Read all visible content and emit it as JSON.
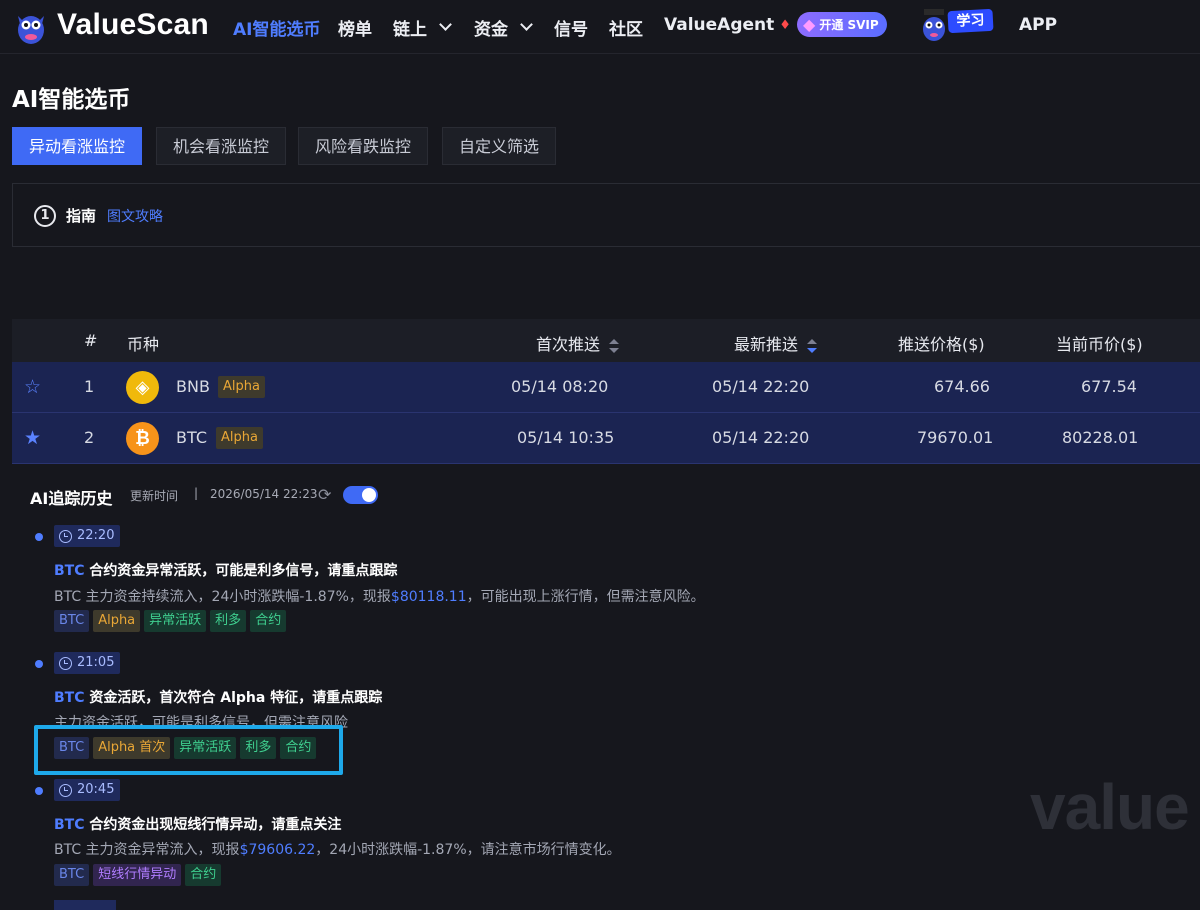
{
  "nav": {
    "logo": "ValueScan",
    "items": [
      {
        "label": "AI智能选币",
        "active": true
      },
      {
        "label": "榜单"
      },
      {
        "label": "链上",
        "dropdown": true
      },
      {
        "label": "资金",
        "dropdown": true
      },
      {
        "label": "信号"
      },
      {
        "label": "社区"
      },
      {
        "label": "ValueAgent"
      },
      {
        "label": "APP"
      }
    ],
    "svip_label": "开通 SVIP",
    "learn_label": "学习"
  },
  "page": {
    "title": "AI智能选币",
    "tabs": [
      "异动看涨监控",
      "机会看涨监控",
      "风险看跌监控",
      "自定义筛选"
    ],
    "active_tab": 0
  },
  "guide": {
    "number": "1",
    "label": "指南",
    "link": "图文攻略"
  },
  "table": {
    "headers": {
      "index": "#",
      "coin": "币种",
      "first_push": "首次推送",
      "latest_push": "最新推送",
      "push_price": "推送价格($)",
      "current_price": "当前币价($)"
    },
    "rows": [
      {
        "index": "1",
        "coin": "BNB",
        "tag": "Alpha",
        "first_push": "05/14 08:20",
        "latest_push": "05/14 22:20",
        "push_price": "674.66",
        "current_price": "677.54",
        "starred": false
      },
      {
        "index": "2",
        "coin": "BTC",
        "tag": "Alpha",
        "first_push": "05/14 10:35",
        "latest_push": "05/14 22:20",
        "push_price": "79670.01",
        "current_price": "80228.01",
        "starred": true
      }
    ]
  },
  "history": {
    "title": "AI追踪历史",
    "updated_label": "更新时间",
    "separator": "|",
    "updated_time": "2026/05/14 22:23",
    "entries": [
      {
        "time": "22:20",
        "symbol": "BTC",
        "title": "合约资金异常活跃，可能是利多信号，请重点跟踪",
        "desc_pre": "BTC 主力资金持续流入，24小时涨跌幅-1.87%，现报",
        "desc_price": "$80118.11",
        "desc_post": "，可能出现上涨行情，但需注意风险。",
        "tags": [
          {
            "t": "BTC",
            "k": "sym"
          },
          {
            "t": "Alpha",
            "k": "alpha"
          },
          {
            "t": "异常活跃",
            "k": "green"
          },
          {
            "t": "利多",
            "k": "green"
          },
          {
            "t": "合约",
            "k": "green"
          }
        ]
      },
      {
        "time": "21:05",
        "symbol": "BTC",
        "title": "资金活跃，首次符合 Alpha 特征，请重点跟踪",
        "desc_pre": "主力资金活跃，可能是利多信号，但需注意风险",
        "desc_price": "",
        "desc_post": "",
        "tags": [
          {
            "t": "BTC",
            "k": "sym"
          },
          {
            "t": "Alpha 首次",
            "k": "alpha"
          },
          {
            "t": "异常活跃",
            "k": "green"
          },
          {
            "t": "利多",
            "k": "green"
          },
          {
            "t": "合约",
            "k": "green"
          }
        ]
      },
      {
        "time": "20:45",
        "symbol": "BTC",
        "title": "合约资金出现短线行情异动，请重点关注",
        "desc_pre": "BTC 主力资金异常流入，现报",
        "desc_price": "$79606.22",
        "desc_post": "，24小时涨跌幅-1.87%，请注意市场行情变化。",
        "tags": [
          {
            "t": "BTC",
            "k": "sym"
          },
          {
            "t": "短线行情异动",
            "k": "purple"
          },
          {
            "t": "合约",
            "k": "green"
          }
        ]
      }
    ]
  },
  "watermark": "value",
  "colors": {
    "accent": "#3f6af5",
    "row_bg": "#1b2452",
    "alpha": "#e9a736",
    "green": "#3fcf8f",
    "highlight": "#1ea9ea"
  }
}
